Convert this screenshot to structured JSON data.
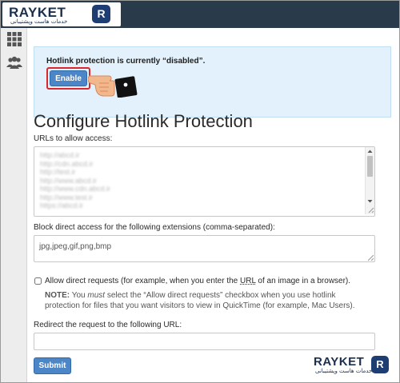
{
  "header": {
    "logo_text": "RAYKET",
    "logo_subtext": "خدمات هاست وپشتیبانی",
    "logo_mark": "R"
  },
  "sidebar": {
    "icons": [
      "apps-grid-icon",
      "users-icon"
    ]
  },
  "alert": {
    "message": "Hotlink protection is currently “disabled”.",
    "enable_label": "Enable"
  },
  "page": {
    "title": "Configure Hotlink Protection"
  },
  "urls_section": {
    "label": "URLs to allow access:"
  },
  "extensions_section": {
    "label": "Block direct access for the following extensions (comma-separated):",
    "value": "jpg,jpeg,gif,png,bmp"
  },
  "allow_direct": {
    "label_before": "Allow direct requests (for example, when you enter the ",
    "label_url": "URL",
    "label_after": " of an image in a browser).",
    "checked": false,
    "note_title": "NOTE:",
    "note_part1": " You ",
    "note_must": "must",
    "note_part2": " select the “Allow direct requests” checkbox when you use hotlink protection for files that you want visitors to view in QuickTime (for example, Mac Users)."
  },
  "redirect_section": {
    "label": "Redirect the request to the following URL:",
    "value": ""
  },
  "submit_label": "Submit",
  "watermark": {
    "text": "RAYKET",
    "subtext": "خدمات هاست وپشتیبانی",
    "mark": "R"
  },
  "colors": {
    "topbar": "#293a4a",
    "alert_bg": "#e2f1fb",
    "button": "#4c86c6",
    "highlight_border": "#d9272e"
  }
}
